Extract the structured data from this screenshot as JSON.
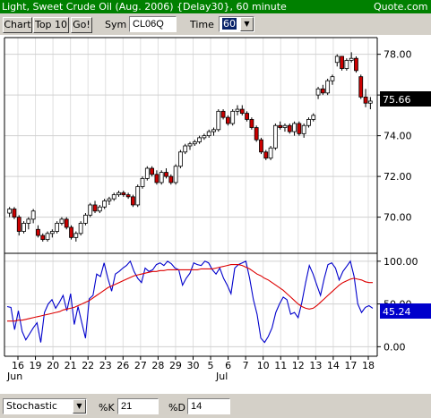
{
  "titlebar": {
    "title": "Light, Sweet Crude Oil (Aug. 2006) {Delay30}, 60 minute",
    "site": "Quote.com  A"
  },
  "toolbar": {
    "chart_label": "Chart",
    "top10_label": "Top 10",
    "go_label": "Go!",
    "sym_label": "Sym",
    "sym_value": "CL06Q",
    "time_label": "Time",
    "time_value": "60"
  },
  "footer": {
    "study_value": "Stochastic",
    "k_label": "%K",
    "k_value": "21",
    "d_label": "%D",
    "d_value": "14"
  },
  "colors": {
    "up": "#ffffff",
    "down": "#cc0000",
    "k_line": "#0000cc",
    "d_line": "#dd0000",
    "last_price_bg": "#000000",
    "stoch_tag_bg": "#0000cc",
    "titlebar_bg": "#008000"
  },
  "chart_data": [
    {
      "type": "candlestick",
      "ylim": [
        68.4,
        78.6
      ],
      "y_ticks": [
        "78.00",
        "76.00",
        "74.00",
        "72.00",
        "70.00"
      ],
      "last_price_label": "75.66",
      "last_price": 75.66,
      "x_tick_labels": [
        "16",
        "19",
        "20",
        "21",
        "22",
        "23",
        "26",
        "27",
        "28",
        "29",
        "30",
        "5",
        "6",
        "7",
        "10",
        "11",
        "12",
        "13",
        "14",
        "17",
        "18"
      ],
      "month_labels": [
        "Jun",
        "Jul"
      ],
      "candles": [
        {
          "o": 70.2,
          "h": 70.5,
          "l": 70.0,
          "c": 70.4
        },
        {
          "o": 70.4,
          "h": 70.5,
          "l": 69.9,
          "c": 70.0
        },
        {
          "o": 70.0,
          "h": 70.1,
          "l": 69.1,
          "c": 69.3
        },
        {
          "o": 69.3,
          "h": 69.8,
          "l": 69.2,
          "c": 69.7
        },
        {
          "o": 69.7,
          "h": 70.0,
          "l": 69.4,
          "c": 69.9
        },
        {
          "o": 69.9,
          "h": 70.4,
          "l": 69.7,
          "c": 70.3
        },
        {
          "o": 69.4,
          "h": 69.6,
          "l": 69.0,
          "c": 69.1
        },
        {
          "o": 69.1,
          "h": 69.2,
          "l": 68.8,
          "c": 68.9
        },
        {
          "o": 68.9,
          "h": 69.3,
          "l": 68.8,
          "c": 69.2
        },
        {
          "o": 69.2,
          "h": 69.4,
          "l": 69.0,
          "c": 69.3
        },
        {
          "o": 69.3,
          "h": 69.8,
          "l": 69.2,
          "c": 69.7
        },
        {
          "o": 69.7,
          "h": 70.0,
          "l": 69.6,
          "c": 69.9
        },
        {
          "o": 69.9,
          "h": 70.0,
          "l": 69.4,
          "c": 69.5
        },
        {
          "o": 69.5,
          "h": 69.6,
          "l": 68.9,
          "c": 69.0
        },
        {
          "o": 69.0,
          "h": 69.3,
          "l": 68.8,
          "c": 69.2
        },
        {
          "o": 69.2,
          "h": 69.8,
          "l": 69.1,
          "c": 69.7
        },
        {
          "o": 69.7,
          "h": 70.2,
          "l": 69.6,
          "c": 70.1
        },
        {
          "o": 70.1,
          "h": 70.7,
          "l": 70.0,
          "c": 70.6
        },
        {
          "o": 70.6,
          "h": 70.8,
          "l": 70.2,
          "c": 70.3
        },
        {
          "o": 70.3,
          "h": 70.6,
          "l": 70.2,
          "c": 70.5
        },
        {
          "o": 70.5,
          "h": 70.9,
          "l": 70.4,
          "c": 70.8
        },
        {
          "o": 70.8,
          "h": 71.0,
          "l": 70.6,
          "c": 70.9
        },
        {
          "o": 70.9,
          "h": 71.2,
          "l": 70.8,
          "c": 71.1
        },
        {
          "o": 71.1,
          "h": 71.3,
          "l": 71.0,
          "c": 71.2
        },
        {
          "o": 71.2,
          "h": 71.3,
          "l": 71.0,
          "c": 71.1
        },
        {
          "o": 71.1,
          "h": 71.2,
          "l": 70.9,
          "c": 71.0
        },
        {
          "o": 71.0,
          "h": 71.1,
          "l": 70.5,
          "c": 70.6
        },
        {
          "o": 70.6,
          "h": 71.6,
          "l": 70.5,
          "c": 71.5
        },
        {
          "o": 71.5,
          "h": 72.0,
          "l": 71.4,
          "c": 71.9
        },
        {
          "o": 71.9,
          "h": 72.5,
          "l": 71.8,
          "c": 72.4
        },
        {
          "o": 72.4,
          "h": 72.5,
          "l": 72.0,
          "c": 72.1
        },
        {
          "o": 72.1,
          "h": 72.3,
          "l": 71.6,
          "c": 71.7
        },
        {
          "o": 71.7,
          "h": 72.3,
          "l": 71.6,
          "c": 72.2
        },
        {
          "o": 72.2,
          "h": 72.4,
          "l": 71.9,
          "c": 72.0
        },
        {
          "o": 72.0,
          "h": 72.1,
          "l": 71.6,
          "c": 71.7
        },
        {
          "o": 71.7,
          "h": 72.6,
          "l": 71.6,
          "c": 72.5
        },
        {
          "o": 72.5,
          "h": 73.3,
          "l": 72.4,
          "c": 73.2
        },
        {
          "o": 73.2,
          "h": 73.6,
          "l": 73.1,
          "c": 73.5
        },
        {
          "o": 73.5,
          "h": 73.7,
          "l": 73.3,
          "c": 73.6
        },
        {
          "o": 73.6,
          "h": 73.8,
          "l": 73.5,
          "c": 73.7
        },
        {
          "o": 73.7,
          "h": 74.0,
          "l": 73.6,
          "c": 73.9
        },
        {
          "o": 73.9,
          "h": 74.1,
          "l": 73.8,
          "c": 74.0
        },
        {
          "o": 74.0,
          "h": 74.3,
          "l": 73.9,
          "c": 74.2
        },
        {
          "o": 74.2,
          "h": 74.4,
          "l": 74.0,
          "c": 74.3
        },
        {
          "o": 74.3,
          "h": 75.3,
          "l": 74.2,
          "c": 75.2
        },
        {
          "o": 75.2,
          "h": 75.3,
          "l": 74.8,
          "c": 74.9
        },
        {
          "o": 74.9,
          "h": 75.0,
          "l": 74.5,
          "c": 74.6
        },
        {
          "o": 74.6,
          "h": 75.3,
          "l": 74.5,
          "c": 75.2
        },
        {
          "o": 75.2,
          "h": 75.5,
          "l": 75.0,
          "c": 75.3
        },
        {
          "o": 75.3,
          "h": 75.5,
          "l": 75.0,
          "c": 75.1
        },
        {
          "o": 75.1,
          "h": 75.2,
          "l": 74.7,
          "c": 74.8
        },
        {
          "o": 74.8,
          "h": 74.9,
          "l": 74.3,
          "c": 74.4
        },
        {
          "o": 74.4,
          "h": 74.5,
          "l": 73.7,
          "c": 73.8
        },
        {
          "o": 73.8,
          "h": 73.9,
          "l": 73.1,
          "c": 73.2
        },
        {
          "o": 73.2,
          "h": 73.3,
          "l": 72.8,
          "c": 72.9
        },
        {
          "o": 72.9,
          "h": 73.5,
          "l": 72.8,
          "c": 73.4
        },
        {
          "o": 73.4,
          "h": 74.6,
          "l": 73.3,
          "c": 74.5
        },
        {
          "o": 74.5,
          "h": 74.7,
          "l": 74.3,
          "c": 74.4
        },
        {
          "o": 74.4,
          "h": 74.6,
          "l": 74.2,
          "c": 74.5
        },
        {
          "o": 74.5,
          "h": 74.6,
          "l": 74.1,
          "c": 74.2
        },
        {
          "o": 74.2,
          "h": 74.7,
          "l": 74.0,
          "c": 74.6
        },
        {
          "o": 74.6,
          "h": 74.7,
          "l": 74.0,
          "c": 74.1
        },
        {
          "o": 74.1,
          "h": 74.6,
          "l": 73.9,
          "c": 74.5
        },
        {
          "o": 74.5,
          "h": 74.9,
          "l": 74.4,
          "c": 74.8
        },
        {
          "o": 74.8,
          "h": 75.1,
          "l": 74.7,
          "c": 75.0
        },
        {
          "o": 76.0,
          "h": 76.4,
          "l": 75.8,
          "c": 76.3
        },
        {
          "o": 76.3,
          "h": 76.5,
          "l": 76.0,
          "c": 76.1
        },
        {
          "o": 76.1,
          "h": 76.8,
          "l": 76.0,
          "c": 76.7
        },
        {
          "o": 76.7,
          "h": 77.0,
          "l": 76.5,
          "c": 76.9
        },
        {
          "o": 77.6,
          "h": 78.0,
          "l": 77.4,
          "c": 77.9
        },
        {
          "o": 77.9,
          "h": 77.9,
          "l": 77.2,
          "c": 77.3
        },
        {
          "o": 77.3,
          "h": 77.8,
          "l": 77.2,
          "c": 77.7
        },
        {
          "o": 77.7,
          "h": 78.1,
          "l": 77.6,
          "c": 77.8
        },
        {
          "o": 77.8,
          "h": 77.9,
          "l": 77.1,
          "c": 77.2
        },
        {
          "o": 76.9,
          "h": 77.0,
          "l": 75.8,
          "c": 75.9
        },
        {
          "o": 75.9,
          "h": 76.3,
          "l": 75.4,
          "c": 75.6
        },
        {
          "o": 75.6,
          "h": 75.9,
          "l": 75.3,
          "c": 75.7
        }
      ]
    },
    {
      "type": "line",
      "title": "Stochastic",
      "ylim": [
        -8,
        104
      ],
      "y_ticks": [
        "100.00",
        "50.00",
        "0.00"
      ],
      "last_value_label": "45.24",
      "series": [
        {
          "name": "%K",
          "values": [
            47,
            46,
            20,
            42,
            18,
            8,
            15,
            22,
            28,
            5,
            40,
            50,
            55,
            45,
            52,
            60,
            42,
            62,
            26,
            47,
            28,
            10,
            56,
            60,
            85,
            82,
            98,
            80,
            65,
            85,
            88,
            92,
            95,
            100,
            88,
            80,
            75,
            92,
            88,
            90,
            96,
            98,
            95,
            100,
            97,
            92,
            90,
            72,
            80,
            86,
            98,
            96,
            95,
            100,
            98,
            90,
            85,
            92,
            80,
            72,
            62,
            92,
            96,
            98,
            100,
            80,
            55,
            38,
            10,
            5,
            12,
            22,
            40,
            50,
            58,
            55,
            38,
            40,
            34,
            52,
            75,
            95,
            85,
            72,
            60,
            80,
            96,
            98,
            92,
            78,
            88,
            94,
            100,
            82,
            50,
            40,
            46,
            48,
            45
          ]
        },
        {
          "name": "%D",
          "values": [
            30,
            30,
            30,
            31,
            31,
            32,
            33,
            34,
            35,
            36,
            37,
            38,
            39,
            40,
            41,
            43,
            44,
            45,
            46,
            48,
            50,
            52,
            54,
            57,
            60,
            63,
            66,
            69,
            71,
            73,
            75,
            77,
            79,
            81,
            83,
            84,
            85,
            86,
            87,
            88,
            88,
            89,
            89,
            90,
            90,
            90,
            90,
            90,
            90,
            90,
            90,
            90,
            91,
            91,
            91,
            91,
            92,
            93,
            94,
            95,
            96,
            96,
            96,
            95,
            93,
            91,
            88,
            85,
            83,
            80,
            78,
            75,
            72,
            69,
            66,
            62,
            58,
            54,
            50,
            47,
            45,
            44,
            45,
            48,
            52,
            56,
            60,
            64,
            68,
            72,
            75,
            77,
            79,
            80,
            79,
            78,
            76,
            75,
            75
          ]
        }
      ]
    }
  ]
}
